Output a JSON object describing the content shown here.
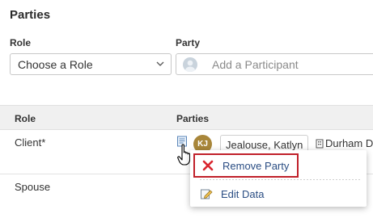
{
  "section": {
    "title": "Parties"
  },
  "form": {
    "role_label": "Role",
    "role_select_value": "Choose a Role",
    "party_label": "Party",
    "party_placeholder": "Add a Participant"
  },
  "table": {
    "headers": {
      "role": "Role",
      "parties": "Parties"
    },
    "rows": [
      {
        "role": "Client*",
        "party_initials": "KJ",
        "party_name": "Jealouse, Katlyn",
        "location": "Durham D"
      },
      {
        "role": "Spouse"
      }
    ]
  },
  "context_menu": {
    "items": [
      {
        "label": "Remove Party",
        "icon": "x-icon"
      },
      {
        "label": "Edit Data",
        "icon": "edit-pencil-icon"
      }
    ]
  },
  "colors": {
    "highlight_border": "#c0202a",
    "menu_text": "#2a4d83",
    "avatar_bg": "#a8863a",
    "header_bg": "#f0f0f0"
  }
}
